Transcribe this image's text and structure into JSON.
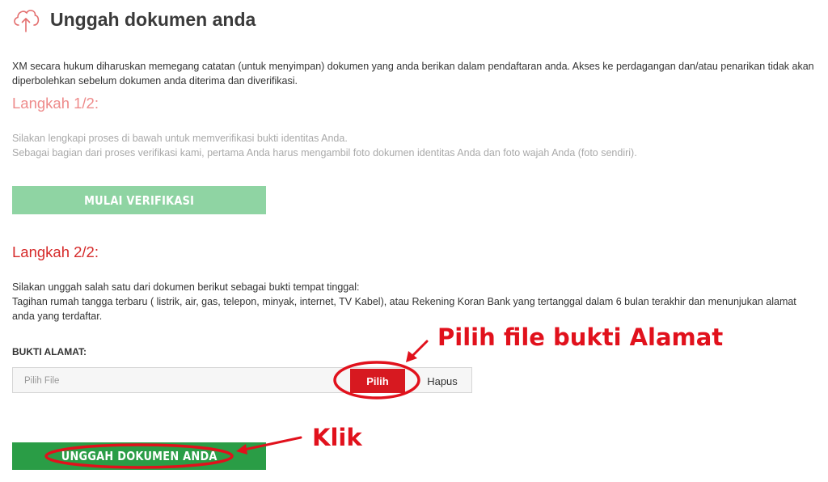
{
  "header": {
    "icon": "cloud-upload-icon",
    "title": "Unggah dokumen anda"
  },
  "intro_text": "XM secara hukum diharuskan memegang catatan (untuk menyimpan) dokumen yang anda berikan dalam pendaftaran anda. Akses ke perdagangan dan/atau penarikan tidak akan diperbolehkan sebelum dokumen anda diterima dan diverifikasi.",
  "step1": {
    "heading": "Langkah 1/2:",
    "line1": "Silakan lengkapi proses di bawah untuk memverifikasi bukti identitas Anda.",
    "line2": "Sebagai bagian dari proses verifikasi kami, pertama Anda harus mengambil foto dokumen identitas Anda dan foto wajah Anda (foto sendiri).",
    "button_label": "MULAI VERIFIKASI"
  },
  "step2": {
    "heading": "Langkah 2/2:",
    "line1": "Silakan unggah salah satu dari dokumen berikut sebagai bukti tempat tinggal:",
    "line2": "Tagihan rumah tangga terbaru ( listrik, air, gas, telepon, minyak, internet, TV Kabel), atau Rekening Koran Bank yang tertanggal dalam 6 bulan terakhir dan menunjukan alamat anda yang terdaftar.",
    "field_label": "BUKTI ALAMAT:",
    "file_placeholder": "Pilih File",
    "choose_label": "Pilih",
    "delete_label": "Hapus",
    "upload_label": "UNGGAH DOKUMEN ANDA"
  },
  "annotations": {
    "choose_note": "Pilih file bukti Alamat",
    "click_note": "Klik",
    "color": "#e1111c"
  },
  "colors": {
    "verify_button": "#8fd4a3",
    "upload_button": "#2a9d46",
    "choose_button": "#d71920",
    "step1_heading": "#ee8b8b",
    "step2_heading": "#d62b2b"
  }
}
